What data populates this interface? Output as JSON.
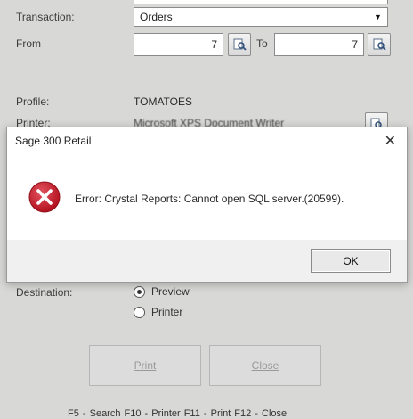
{
  "form": {
    "transaction_label": "Transaction:",
    "transaction_value": "Orders",
    "from_label": "From",
    "from_value": "7",
    "to_label": "To",
    "to_value": "7",
    "profile_label": "Profile:",
    "profile_value": "TOMATOES",
    "printer_label": "Printer:",
    "printer_value": "Microsoft XPS Document Writer",
    "destination_label": "Destination:",
    "destination_options": [
      "Preview",
      "Printer"
    ],
    "destination_selected": "Preview",
    "print_button": "Print",
    "close_button": "Close",
    "shortcuts": "F5 - Search  F10 - Printer  F11 - Print  F12 - Close"
  },
  "dialog": {
    "title": "Sage 300 Retail",
    "close_glyph": "✕",
    "message": "Error: Crystal Reports: Cannot open SQL server.(20599).",
    "ok_button": "OK",
    "icon": "error-icon",
    "icon_color": "#c8202f"
  }
}
